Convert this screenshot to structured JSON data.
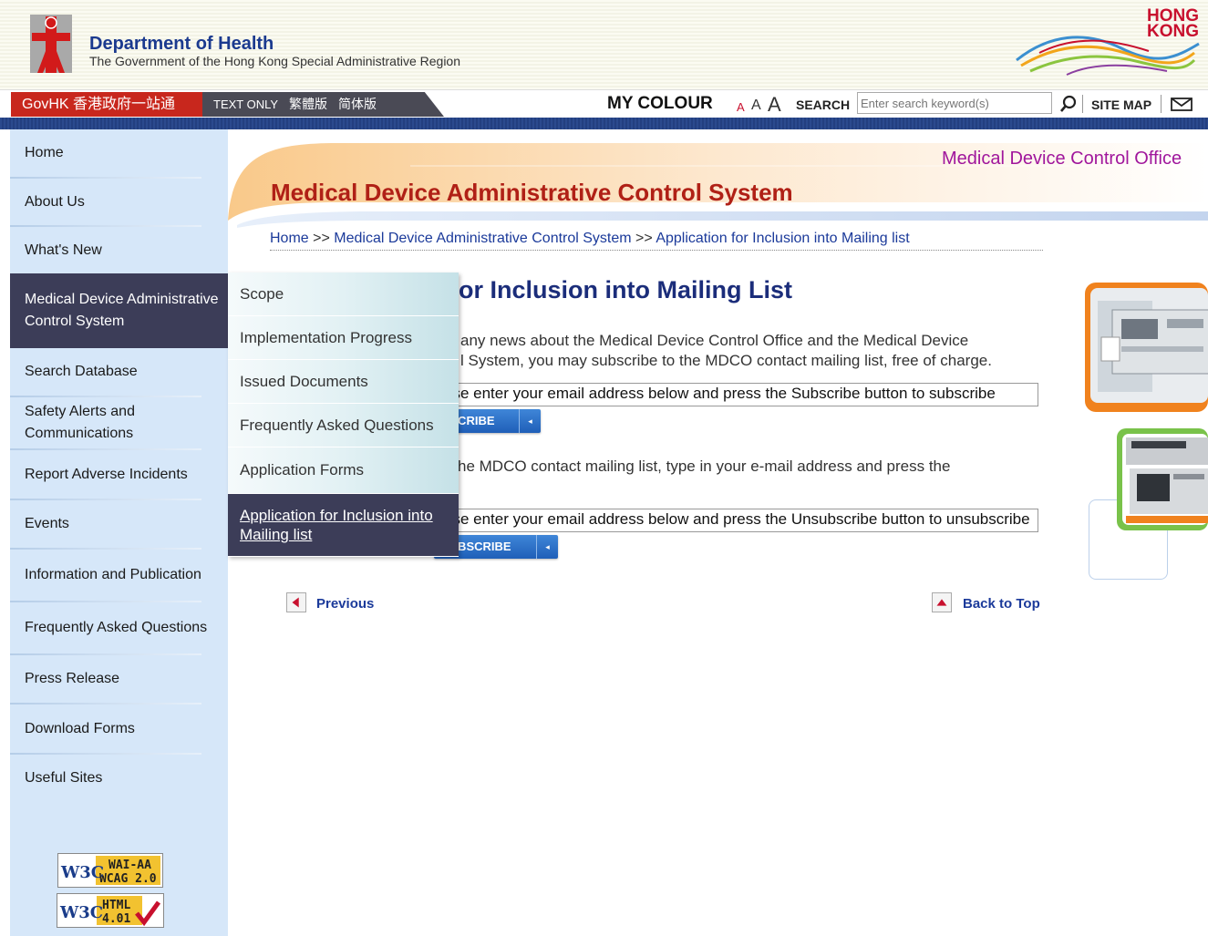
{
  "header": {
    "dept_name": "Department of Health",
    "dept_sub": "The Government of the Hong Kong Special Administrative Region",
    "brand_line1": "HONG",
    "brand_line2": "KONG"
  },
  "toolbar": {
    "govhk": "GovHK 香港政府一站通",
    "text_only": "TEXT ONLY",
    "traditional": "繁體版",
    "simplified": "简体版",
    "my_colour": "MY COLOUR",
    "font_small": "A",
    "font_medium": "A",
    "font_large": "A",
    "search_label": "SEARCH",
    "search_placeholder": "Enter search keyword(s)",
    "site_map": "SITE MAP"
  },
  "sidebar": {
    "items": [
      {
        "label": "Home"
      },
      {
        "label": "About Us"
      },
      {
        "label": "What's New"
      },
      {
        "label": "Medical Device Administrative Control System"
      },
      {
        "label": "Search Database"
      },
      {
        "label": "Safety Alerts and Communications"
      },
      {
        "label": "Report Adverse Incidents"
      },
      {
        "label": "Events"
      },
      {
        "label": "Information and Publication"
      },
      {
        "label": "Frequently Asked Questions"
      },
      {
        "label": "Press Release"
      },
      {
        "label": "Download Forms"
      },
      {
        "label": "Useful Sites"
      }
    ],
    "badges": {
      "wai_line1": "WAI-AA",
      "wai_line2": "WCAG 2.0",
      "html_line1": "HTML",
      "html_line2": "4.01",
      "w3c": "W3C"
    }
  },
  "banner": {
    "office": "Medical Device Control Office",
    "system": "Medical Device Administrative Control System"
  },
  "breadcrumb": {
    "home": "Home",
    "sep": " >> ",
    "level1": "Medical Device Administrative Control System",
    "level2": "Application for Inclusion into Mailing list"
  },
  "submenu": {
    "items": [
      {
        "label": "Scope"
      },
      {
        "label": "Implementation Progress"
      },
      {
        "label": "Issued Documents"
      },
      {
        "label": "Frequently Asked Questions"
      },
      {
        "label": "Application Forms"
      },
      {
        "label": "Application for Inclusion into Mailing list"
      }
    ]
  },
  "content": {
    "title": "or Inclusion into Mailing List",
    "intro_line1": "any news about the Medical Device Control Office and the Medical Device",
    "intro_line2": "l System, you may subscribe to the MDCO contact mailing list, free of charge.",
    "subscribe_input_value": "ase enter your email address below and press the Subscribe button to subscribe",
    "subscribe_button": "BSCRIBE",
    "unsub_line1": "he MDCO contact mailing list, type in your e-mail address and press the",
    "unsubscribe_input_value": "ase enter your email address below and press the Unsubscribe button to unsubscribe",
    "unsubscribe_button": "SUBSCRIBE",
    "previous": "Previous",
    "back_to_top": "Back to Top"
  },
  "colors": {
    "active_nav": "#3c3d58",
    "sidebar_bg": "#d6e7f9",
    "title_red": "#b02016",
    "office_purple": "#a0169c",
    "link_blue": "#1b3a9a"
  }
}
